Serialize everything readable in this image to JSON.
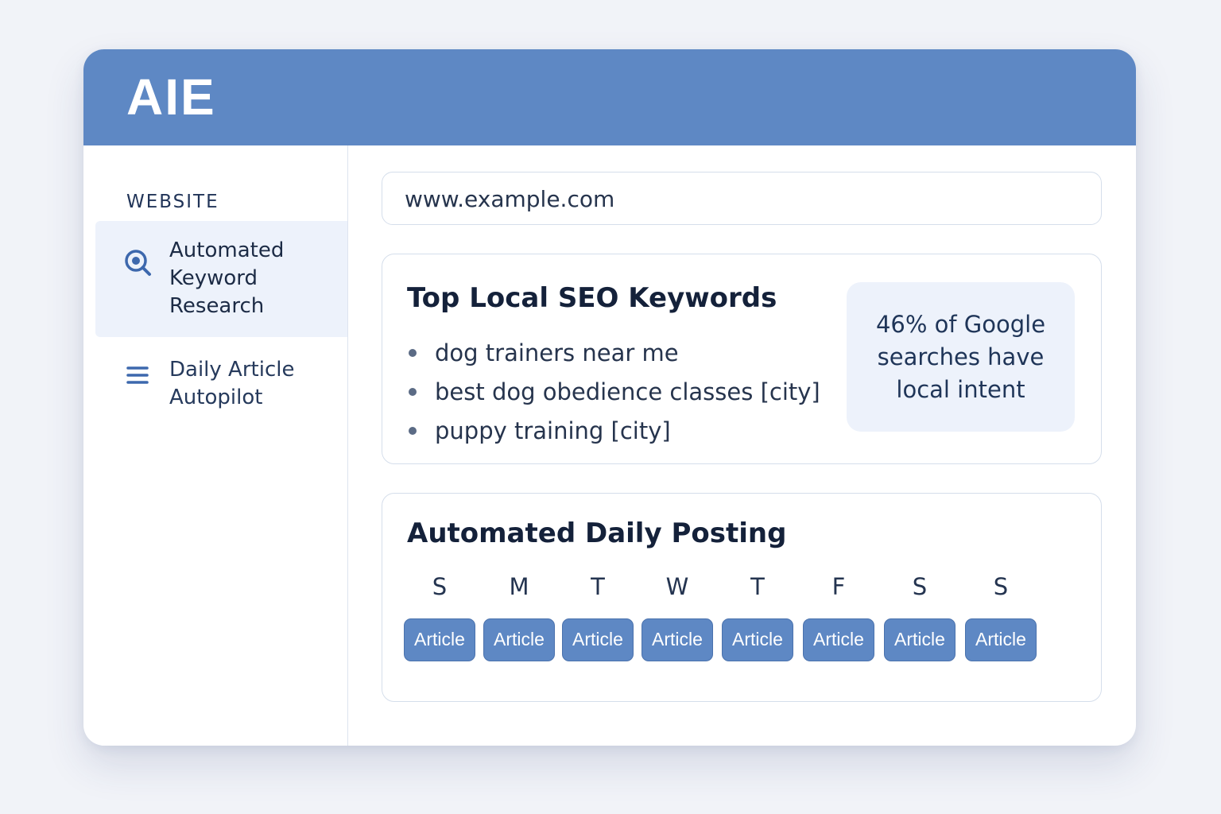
{
  "app": {
    "logo_text": "AIE",
    "accent_color": "#5e88c4"
  },
  "sidebar": {
    "heading": "WEBSITE",
    "items": [
      {
        "label": "Automated Keyword Research",
        "icon": "search-target-icon",
        "active": true
      },
      {
        "label": "Daily Article Autopilot",
        "icon": "list-icon",
        "active": false
      }
    ]
  },
  "url_bar": {
    "value": "www.example.com"
  },
  "keywords_card": {
    "title": "Top Local SEO Keywords",
    "keywords": [
      "dog trainers near me",
      "best dog obedience classes [city]",
      "puppy training [city]"
    ],
    "stat": "46% of Google searches have local intent"
  },
  "posting_card": {
    "title": "Automated Daily Posting",
    "days": [
      {
        "letter": "S",
        "button": "Article"
      },
      {
        "letter": "M",
        "button": "Article"
      },
      {
        "letter": "T",
        "button": "Article"
      },
      {
        "letter": "W",
        "button": "Article"
      },
      {
        "letter": "T",
        "button": "Article"
      },
      {
        "letter": "F",
        "button": "Article"
      },
      {
        "letter": "S",
        "button": "Article"
      },
      {
        "letter": "S",
        "button": "Article"
      }
    ]
  }
}
